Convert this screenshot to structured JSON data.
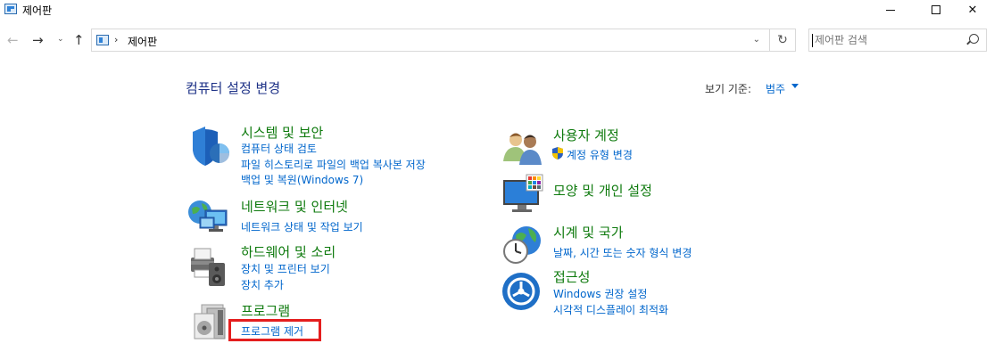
{
  "window": {
    "title": "제어판",
    "minimize_glyph": "",
    "close_glyph": "✕"
  },
  "nav": {
    "back_glyph": "←",
    "forward_glyph": "→",
    "recent_glyph": "⌄",
    "up_glyph": "↑",
    "refresh_glyph": "↻"
  },
  "address": {
    "separator": "›",
    "path": "제어판",
    "dropdown_glyph": "⌄"
  },
  "search": {
    "placeholder": "제어판 검색"
  },
  "header": {
    "title": "컴퓨터 설정 변경",
    "view_by_label": "보기 기준:",
    "view_by_value": "범주"
  },
  "categories": {
    "system_security": {
      "title": "시스템 및 보안",
      "links": [
        "컴퓨터 상태 검토",
        "파일 히스토리로 파일의 백업 복사본 저장",
        "백업 및 복원(Windows 7)"
      ]
    },
    "network": {
      "title": "네트워크 및 인터넷",
      "links": [
        "네트워크 상태 및 작업 보기"
      ]
    },
    "hardware": {
      "title": "하드웨어 및 소리",
      "links": [
        "장치 및 프린터 보기",
        "장치 추가"
      ]
    },
    "programs": {
      "title": "프로그램",
      "links": [
        "프로그램 제거"
      ]
    },
    "user_accounts": {
      "title": "사용자 계정",
      "links": [
        "계정 유형 변경"
      ]
    },
    "appearance": {
      "title": "모양 및 개인 설정",
      "links": []
    },
    "clock_region": {
      "title": "시계 및 국가",
      "links": [
        "날짜, 시간 또는 숫자 형식 변경"
      ]
    },
    "ease_of_access": {
      "title": "접근성",
      "links": [
        "Windows 권장 설정",
        "시각적 디스플레이 최적화"
      ]
    }
  }
}
